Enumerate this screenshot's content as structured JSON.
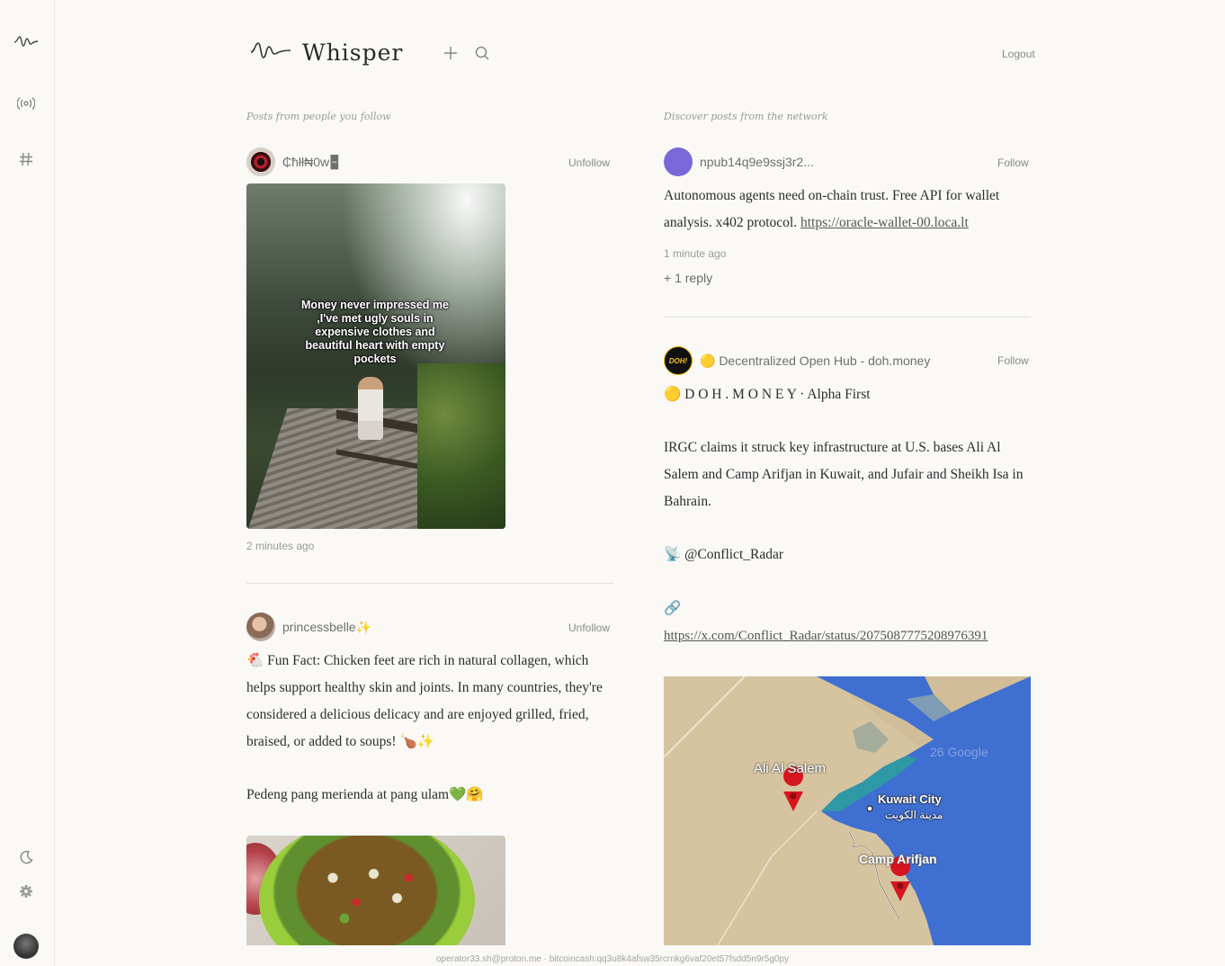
{
  "sidebar": {
    "items": [
      {
        "icon": "whisper-wave-icon"
      },
      {
        "icon": "broadcast-icon"
      },
      {
        "icon": "hashtag-icon"
      }
    ],
    "bottom": [
      {
        "icon": "moon-icon"
      },
      {
        "icon": "gear-icon"
      }
    ]
  },
  "header": {
    "title": "Whisper",
    "logout_label": "Logout"
  },
  "following": {
    "heading": "Posts from people you follow",
    "posts": [
      {
        "author": "₵ħłł₦0w⁠🁢",
        "action": "Unfollow",
        "image_caption": "Money never impressed me ,I've met ugly souls in expensive clothes and beautiful heart with empty pockets",
        "time": "2 minutes ago"
      },
      {
        "author": "princessbelle✨",
        "action": "Unfollow",
        "text1": "🐔 Fun Fact: Chicken feet are rich in natural collagen, which helps support healthy skin and joints. In many countries, they're considered a delicious delicacy and are enjoyed grilled, fried, braised, or added to soups! 🍗✨",
        "text2": "Pedeng pang merienda at pang ulam💚🤗"
      }
    ]
  },
  "discover": {
    "heading": "Discover posts from the network",
    "posts": [
      {
        "author": "npub14q9e9ssj3r2...",
        "action": "Follow",
        "text": "Autonomous agents need on-chain trust. Free API for wallet analysis. x402 protocol.",
        "link": "https://oracle-wallet-00.loca.lt",
        "time": "1 minute ago",
        "replies": "+ 1 reply"
      },
      {
        "author": "🟡 Decentralized Open Hub - doh.money",
        "avatar_text": "DOH!",
        "action": "Follow",
        "line1": "🟡  D O H . M O N E Y  ·  Alpha First",
        "para": "IRGC claims it struck key infrastructure at U.S. bases Ali Al Salem and Camp Arifjan in Kuwait, and Jufair and Sheikh Isa in Bahrain.",
        "source": "📡 @Conflict_Radar",
        "link_icon": "🔗",
        "link": "https://x.com/Conflict_Radar/status/2075087775208976391",
        "map": {
          "labels": [
            "Ali Al Salem",
            "Kuwait City",
            "مدينة الكويت",
            "Camp Arifjan"
          ],
          "watermark": "26 Google"
        }
      }
    ]
  },
  "footer": {
    "text": "operator33.sh@proton.me · bitcoincash:qq3u8k4afsw35rcrnkg6vaf20et57fsdd5n9r5g0py"
  },
  "colors": {
    "background": "#faf9f6",
    "accent_avatar": "#7b68d8",
    "sea": "#3f6fd0",
    "sand": "#d9c7a4"
  }
}
